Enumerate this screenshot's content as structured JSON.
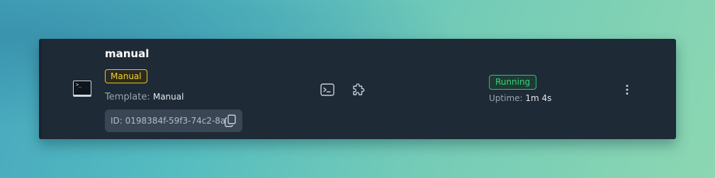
{
  "instance": {
    "name": "manual",
    "type_badge": "Manual",
    "template_label": "Template:",
    "template_value": "Manual",
    "id_text": "ID: 0198384f-59f3-74c2-8a",
    "status": "Running",
    "uptime_label": "Uptime:",
    "uptime_value": "1m 4s",
    "thumbnail_prompt": ">_"
  },
  "icons": {
    "thumbnail": "terminal-thumbnail-icon",
    "copy": "copy-icon",
    "terminal": "terminal-icon",
    "extensions": "puzzle-icon",
    "more": "more-vertical-icon"
  },
  "colors": {
    "card_background": "#1f2a37",
    "manual_badge": "#f2d230",
    "running_badge": "#36d27a",
    "id_chip_background": "#3a4654"
  }
}
